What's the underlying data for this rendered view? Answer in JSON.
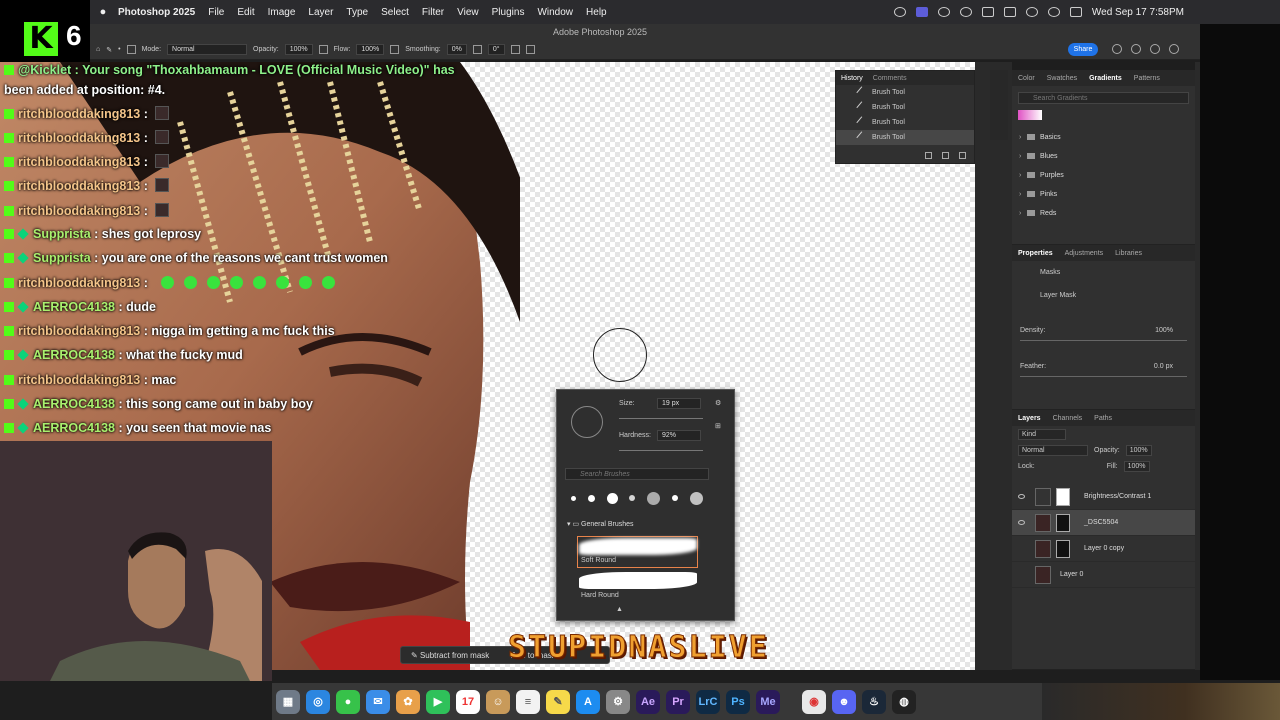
{
  "menubar": {
    "app": "Photoshop 2025",
    "menus": [
      "File",
      "Edit",
      "Image",
      "Layer",
      "Type",
      "Select",
      "Filter",
      "View",
      "Plugins",
      "Window",
      "Help"
    ],
    "clock": "Wed Sep 17  7:58PM"
  },
  "window_title": "Adobe Photoshop 2025",
  "options": {
    "mode_label": "Mode:",
    "mode_value": "Normal",
    "opacity_label": "Opacity:",
    "opacity_value": "100%",
    "flow_label": "Flow:",
    "flow_value": "100%",
    "smoothing_label": "Smoothing:",
    "smoothing_value": "0%",
    "angle_value": "0°",
    "share": "Share"
  },
  "stream": {
    "logo_count": "6",
    "notice_line1": "@Kicklet : Your song \"Thoxahbamaum - LOVE (Official Music Video)\" has",
    "notice_line2": "been added at position: #4.",
    "messages": [
      {
        "user": "ritchblooddaking813",
        "text": ""
      },
      {
        "user": "ritchblooddaking813",
        "text": ""
      },
      {
        "user": "ritchblooddaking813",
        "text": ""
      },
      {
        "user": "ritchblooddaking813",
        "text": ""
      },
      {
        "user": "ritchblooddaking813",
        "text": ""
      },
      {
        "user": "Supprista",
        "text": "shes got leprosy"
      },
      {
        "user": "Supprista",
        "text": "you are one of the reasons we cant trust women"
      },
      {
        "user": "ritchblooddaking813",
        "text": ""
      },
      {
        "user": "AERROC4138",
        "text": "dude"
      },
      {
        "user": "ritchblooddaking813",
        "text": "nigga im getting a mc fuck this"
      },
      {
        "user": "AERROC4138",
        "text": "what the fucky mud"
      },
      {
        "user": "ritchblooddaking813",
        "text": "mac"
      },
      {
        "user": "AERROC4138",
        "text": "this song came out in baby boy"
      },
      {
        "user": "AERROC4138",
        "text": "you seen that movie nas"
      }
    ],
    "overlay_title": "STUPIDNASLIVE"
  },
  "history": {
    "tabs": [
      "History",
      "Comments"
    ],
    "items": [
      "Brush Tool",
      "Brush Tool",
      "Brush Tool",
      "Brush Tool"
    ]
  },
  "gradients": {
    "tabs": [
      "Color",
      "Swatches",
      "Gradients",
      "Patterns"
    ],
    "search_placeholder": "Search Gradients",
    "folders": [
      "Basics",
      "Blues",
      "Purples",
      "Pinks",
      "Reds"
    ]
  },
  "properties": {
    "tabs": [
      "Properties",
      "Adjustments",
      "Libraries"
    ],
    "section": "Masks",
    "mask_label": "Layer Mask",
    "density_label": "Density:",
    "density_value": "100%",
    "feather_label": "Feather:",
    "feather_value": "0.0 px"
  },
  "layers": {
    "tabs": [
      "Layers",
      "Channels",
      "Paths"
    ],
    "filter": "Kind",
    "blend": "Normal",
    "opacity_label": "Opacity:",
    "opacity_value": "100%",
    "lock_label": "Lock:",
    "fill_label": "Fill:",
    "fill_value": "100%",
    "items": [
      "Brightness/Contrast 1",
      "_DSC5504",
      "Layer 0 copy",
      "Layer 0"
    ]
  },
  "brush_picker": {
    "size_label": "Size:",
    "size_value": "19 px",
    "hardness_label": "Hardness:",
    "hardness_value": "92%",
    "search_placeholder": "Search Brushes",
    "folder": "General Brushes",
    "presets": [
      "Soft Round",
      "Hard Round"
    ]
  },
  "taskbar": {
    "subtract": "Subtract from mask",
    "add": "Add to mask"
  },
  "dock": {
    "apps": [
      "Launchpad",
      "Safari",
      "Messages",
      "Mail",
      "Photos",
      "FaceTime",
      "Calendar",
      "Finder",
      "Reminders",
      "Notes",
      "App Store",
      "Settings",
      "Ae",
      "Pr",
      "LrC",
      "Ps",
      "Me",
      "Chrome",
      "Discord",
      "Steam",
      "OBS"
    ],
    "calendar_day": "17"
  },
  "colors": {
    "kick_green": "#53fc18",
    "share_blue": "#1f73e8",
    "selection_orange": "#e8834a"
  }
}
